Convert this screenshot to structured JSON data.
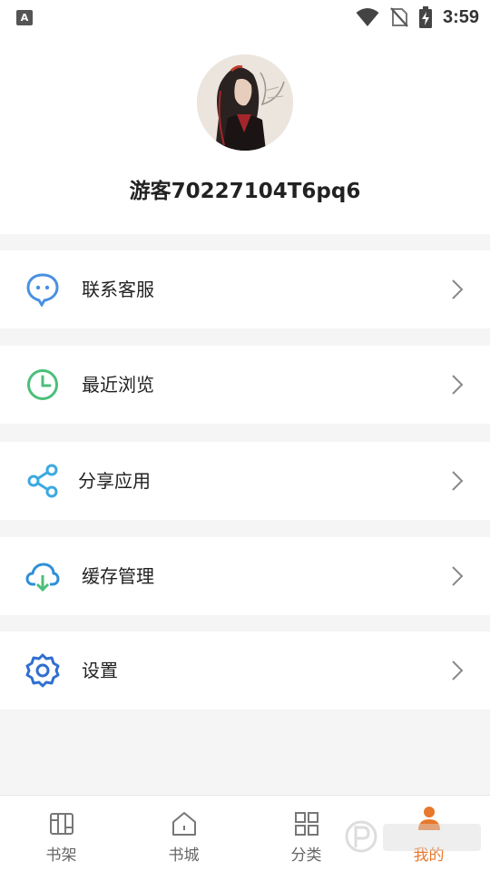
{
  "status_bar": {
    "time": "3:59",
    "indicator_icon": "a-notification-icon",
    "indicator_letter": "A"
  },
  "profile": {
    "username": "游客70227104T6pq6",
    "avatar_icon": "user-avatar"
  },
  "menu": [
    {
      "label": "联系客服",
      "icon": "chat-bubble-icon",
      "color": "#4a90e2"
    },
    {
      "label": "最近浏览",
      "icon": "clock-icon",
      "color": "#4cbf7a"
    },
    {
      "label": "分享应用",
      "icon": "share-icon",
      "color": "#3ba9e0"
    },
    {
      "label": "缓存管理",
      "icon": "cloud-download-icon",
      "color": "#2f8fd8"
    },
    {
      "label": "设置",
      "icon": "gear-icon",
      "color": "#2f6fd0"
    }
  ],
  "bottom_nav": [
    {
      "label": "书架",
      "icon": "bookshelf-icon",
      "active": false
    },
    {
      "label": "书城",
      "icon": "home-icon",
      "active": false
    },
    {
      "label": "分类",
      "icon": "category-grid-icon",
      "active": false
    },
    {
      "label": "我的",
      "icon": "person-icon",
      "active": true
    }
  ],
  "colors": {
    "active": "#e8782c",
    "inactive": "#666666",
    "background": "#f5f5f5"
  }
}
